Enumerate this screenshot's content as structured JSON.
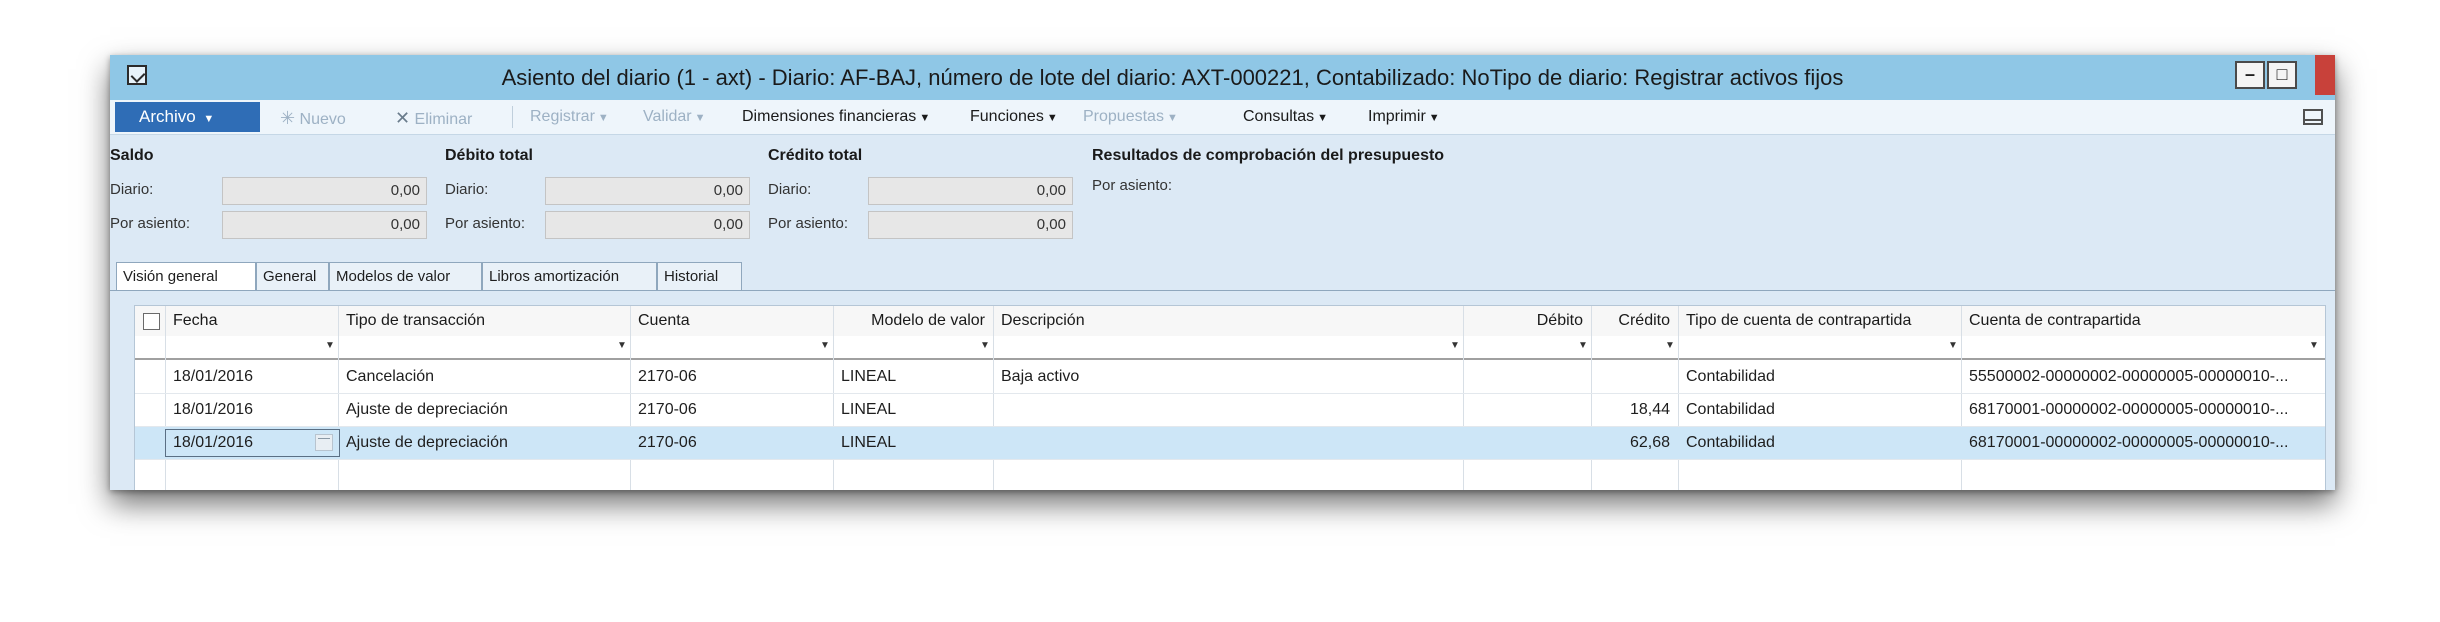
{
  "window": {
    "title": "Asiento del diario (1 - axt) - Diario: AF-BAJ, número de lote del diario: AXT-000221, Contabilizado: NoTipo de diario: Registrar activos fijos",
    "min_glyph": "–",
    "max_glyph": "□"
  },
  "toolbar": {
    "archivo": "Archivo",
    "nuevo": "Nuevo",
    "eliminar": "Eliminar",
    "registrar": "Registrar",
    "validar": "Validar",
    "dimensiones": "Dimensiones financieras",
    "funciones": "Funciones",
    "propuestas": "Propuestas",
    "consultas": "Consultas",
    "imprimir": "Imprimir"
  },
  "header": {
    "saldo": {
      "title": "Saldo",
      "diario_label": "Diario:",
      "diario_value": "0,00",
      "asiento_label": "Por asiento:",
      "asiento_value": "0,00"
    },
    "debito": {
      "title": "Débito total",
      "diario_label": "Diario:",
      "diario_value": "0,00",
      "asiento_label": "Por asiento:",
      "asiento_value": "0,00"
    },
    "credito": {
      "title": "Crédito total",
      "diario_label": "Diario:",
      "diario_value": "0,00",
      "asiento_label": "Por asiento:",
      "asiento_value": "0,00"
    },
    "presupuesto": {
      "title": "Resultados de comprobación del presupuesto",
      "asiento_label": "Por asiento:"
    }
  },
  "tabs": [
    "Visión general",
    "General",
    "Modelos de valor",
    "Libros amortización",
    "Historial"
  ],
  "grid": {
    "columns": [
      "Fecha",
      "Tipo de transacción",
      "Cuenta",
      "Modelo de valor",
      "Descripción",
      "Débito",
      "Crédito",
      "Tipo de cuenta de contrapartida",
      "Cuenta de contrapartida"
    ],
    "rows": [
      {
        "fecha": "18/01/2016",
        "tipo": "Cancelación",
        "cuenta": "2170-06",
        "modelo": "LINEAL",
        "descripcion": "Baja activo",
        "debito": "",
        "credito": "",
        "tipo_contra": "Contabilidad",
        "cuenta_contra": "55500002-00000002-00000005-00000010-..."
      },
      {
        "fecha": "18/01/2016",
        "tipo": "Ajuste de depreciación",
        "cuenta": "2170-06",
        "modelo": "LINEAL",
        "descripcion": "",
        "debito": "",
        "credito": "18,44",
        "tipo_contra": "Contabilidad",
        "cuenta_contra": "68170001-00000002-00000005-00000010-..."
      },
      {
        "fecha": "18/01/2016",
        "tipo": "Ajuste de depreciación",
        "cuenta": "2170-06",
        "modelo": "LINEAL",
        "descripcion": "",
        "debito": "",
        "credito": "62,68",
        "tipo_contra": "Contabilidad",
        "cuenta_contra": "68170001-00000002-00000005-00000010-..."
      }
    ]
  },
  "colors": {
    "titlebar": "#8fc7e6",
    "archivo_button": "#2f6db6",
    "selected_row": "#cde6f7",
    "close_button": "#c8413a"
  }
}
